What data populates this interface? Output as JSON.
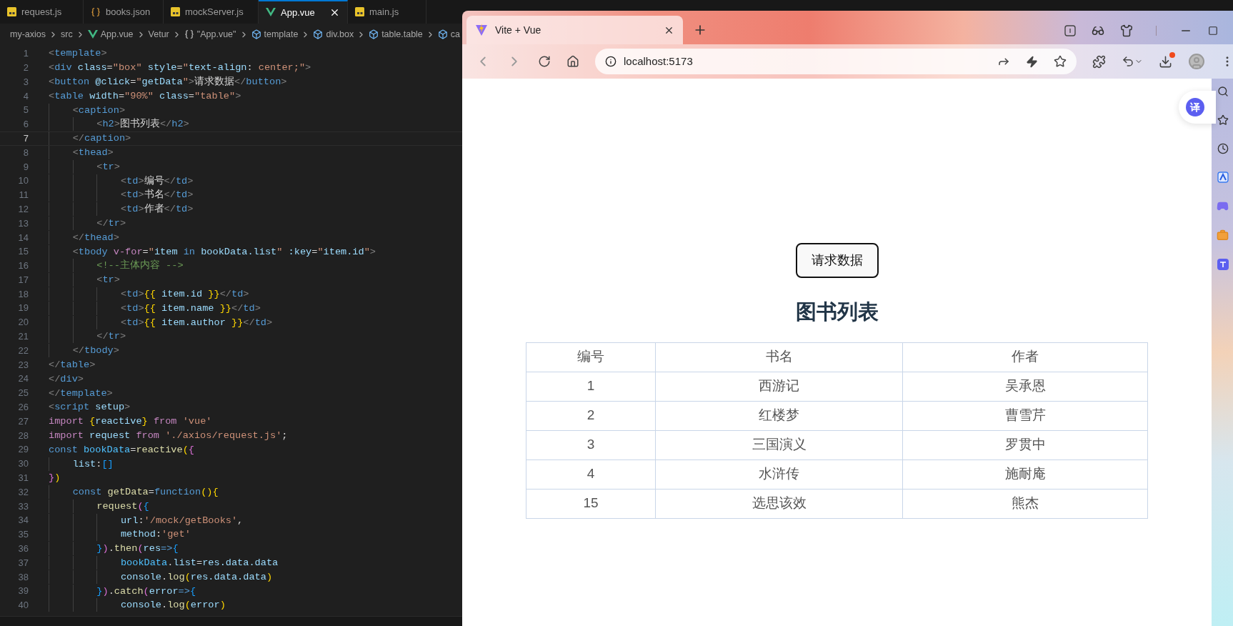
{
  "editor": {
    "tabs": [
      {
        "label": "request.js",
        "kind": "js",
        "selected": false
      },
      {
        "label": "books.json",
        "kind": "json",
        "selected": false
      },
      {
        "label": "mockServer.js",
        "kind": "js",
        "selected": false
      },
      {
        "label": "App.vue",
        "kind": "vue",
        "selected": true
      },
      {
        "label": "main.js",
        "kind": "js",
        "selected": false
      }
    ],
    "breadcrumbs": [
      {
        "label": "my-axios",
        "kind": "folder"
      },
      {
        "label": "src",
        "kind": "folder"
      },
      {
        "label": "App.vue",
        "kind": "vue"
      },
      {
        "label": "Vetur",
        "kind": "folder"
      },
      {
        "label": "\"App.vue\"",
        "kind": "braces"
      },
      {
        "label": "template",
        "kind": "element"
      },
      {
        "label": "div.box",
        "kind": "element"
      },
      {
        "label": "table.table",
        "kind": "element"
      },
      {
        "label": "ca",
        "kind": "element"
      }
    ],
    "lines": [
      {
        "number": "1",
        "current": false,
        "tokens": [
          {
            "text": "<",
            "kind": "punct"
          },
          {
            "text": "template",
            "kind": "tag"
          },
          {
            "text": ">",
            "kind": "punct"
          }
        ]
      },
      {
        "number": "2",
        "current": false,
        "tokens": [
          {
            "text": "<",
            "kind": "punct"
          },
          {
            "text": "div",
            "kind": "tag"
          },
          {
            "text": " class",
            "kind": "attr"
          },
          {
            "text": "=",
            "kind": "text"
          },
          {
            "text": "\"box\"",
            "kind": "string"
          },
          {
            "text": " style",
            "kind": "attr"
          },
          {
            "text": "=",
            "kind": "text"
          },
          {
            "text": "\"",
            "kind": "string"
          },
          {
            "text": "text-align",
            "kind": "attr"
          },
          {
            "text": ": ",
            "kind": "text"
          },
          {
            "text": "center;",
            "kind": "string"
          },
          {
            "text": "\"",
            "kind": "string"
          },
          {
            "text": ">",
            "kind": "punct"
          }
        ]
      },
      {
        "number": "3",
        "current": false,
        "tokens": [
          {
            "text": "<",
            "kind": "punct"
          },
          {
            "text": "button",
            "kind": "tag"
          },
          {
            "text": " @click",
            "kind": "attr"
          },
          {
            "text": "=",
            "kind": "text"
          },
          {
            "text": "\"",
            "kind": "string"
          },
          {
            "text": "getData",
            "kind": "variable"
          },
          {
            "text": "\"",
            "kind": "string"
          },
          {
            "text": ">",
            "kind": "punct"
          },
          {
            "text": "请求数据",
            "kind": "text"
          },
          {
            "text": "</",
            "kind": "punct"
          },
          {
            "text": "button",
            "kind": "tag"
          },
          {
            "text": ">",
            "kind": "punct"
          }
        ]
      },
      {
        "number": "4",
        "current": false,
        "tokens": [
          {
            "text": "<",
            "kind": "punct"
          },
          {
            "text": "table",
            "kind": "tag"
          },
          {
            "text": " width",
            "kind": "attr"
          },
          {
            "text": "=",
            "kind": "text"
          },
          {
            "text": "\"90%\"",
            "kind": "string"
          },
          {
            "text": " class",
            "kind": "attr"
          },
          {
            "text": "=",
            "kind": "text"
          },
          {
            "text": "\"table\"",
            "kind": "string"
          },
          {
            "text": ">",
            "kind": "punct"
          }
        ]
      },
      {
        "number": "5",
        "current": false,
        "tokens": [
          {
            "text": "    <",
            "kind": "punct"
          },
          {
            "text": "caption",
            "kind": "tag"
          },
          {
            "text": ">",
            "kind": "punct"
          }
        ]
      },
      {
        "number": "6",
        "current": false,
        "tokens": [
          {
            "text": "        <",
            "kind": "punct"
          },
          {
            "text": "h2",
            "kind": "tag"
          },
          {
            "text": ">",
            "kind": "punct"
          },
          {
            "text": "图书列表",
            "kind": "text"
          },
          {
            "text": "</",
            "kind": "punct"
          },
          {
            "text": "h2",
            "kind": "tag"
          },
          {
            "text": ">",
            "kind": "punct"
          }
        ]
      },
      {
        "number": "7",
        "current": true,
        "tokens": [
          {
            "text": "    </",
            "kind": "punct"
          },
          {
            "text": "caption",
            "kind": "tag"
          },
          {
            "text": ">",
            "kind": "punct"
          }
        ]
      },
      {
        "number": "8",
        "current": false,
        "tokens": [
          {
            "text": "    <",
            "kind": "punct"
          },
          {
            "text": "thead",
            "kind": "tag"
          },
          {
            "text": ">",
            "kind": "punct"
          }
        ]
      },
      {
        "number": "9",
        "current": false,
        "tokens": [
          {
            "text": "        <",
            "kind": "punct"
          },
          {
            "text": "tr",
            "kind": "tag"
          },
          {
            "text": ">",
            "kind": "punct"
          }
        ]
      },
      {
        "number": "10",
        "current": false,
        "tokens": [
          {
            "text": "            <",
            "kind": "punct"
          },
          {
            "text": "td",
            "kind": "tag"
          },
          {
            "text": ">",
            "kind": "punct"
          },
          {
            "text": "编号",
            "kind": "text"
          },
          {
            "text": "</",
            "kind": "punct"
          },
          {
            "text": "td",
            "kind": "tag"
          },
          {
            "text": ">",
            "kind": "punct"
          }
        ]
      },
      {
        "number": "11",
        "current": false,
        "tokens": [
          {
            "text": "            <",
            "kind": "punct"
          },
          {
            "text": "td",
            "kind": "tag"
          },
          {
            "text": ">",
            "kind": "punct"
          },
          {
            "text": "书名",
            "kind": "text"
          },
          {
            "text": "</",
            "kind": "punct"
          },
          {
            "text": "td",
            "kind": "tag"
          },
          {
            "text": ">",
            "kind": "punct"
          }
        ]
      },
      {
        "number": "12",
        "current": false,
        "tokens": [
          {
            "text": "            <",
            "kind": "punct"
          },
          {
            "text": "td",
            "kind": "tag"
          },
          {
            "text": ">",
            "kind": "punct"
          },
          {
            "text": "作者",
            "kind": "text"
          },
          {
            "text": "</",
            "kind": "punct"
          },
          {
            "text": "td",
            "kind": "tag"
          },
          {
            "text": ">",
            "kind": "punct"
          }
        ]
      },
      {
        "number": "13",
        "current": false,
        "tokens": [
          {
            "text": "        </",
            "kind": "punct"
          },
          {
            "text": "tr",
            "kind": "tag"
          },
          {
            "text": ">",
            "kind": "punct"
          }
        ]
      },
      {
        "number": "14",
        "current": false,
        "tokens": [
          {
            "text": "    </",
            "kind": "punct"
          },
          {
            "text": "thead",
            "kind": "tag"
          },
          {
            "text": ">",
            "kind": "punct"
          }
        ]
      },
      {
        "number": "15",
        "current": false,
        "tokens": [
          {
            "text": "    <",
            "kind": "punct"
          },
          {
            "text": "tbody",
            "kind": "tag"
          },
          {
            "text": " v-for",
            "kind": "keyword"
          },
          {
            "text": "=",
            "kind": "text"
          },
          {
            "text": "\"",
            "kind": "string"
          },
          {
            "text": "item ",
            "kind": "variable"
          },
          {
            "text": "in",
            "kind": "storage"
          },
          {
            "text": " bookData.list",
            "kind": "variable"
          },
          {
            "text": "\"",
            "kind": "string"
          },
          {
            "text": " :key",
            "kind": "attr"
          },
          {
            "text": "=",
            "kind": "text"
          },
          {
            "text": "\"",
            "kind": "string"
          },
          {
            "text": "item.id",
            "kind": "variable"
          },
          {
            "text": "\"",
            "kind": "string"
          },
          {
            "text": ">",
            "kind": "punct"
          }
        ]
      },
      {
        "number": "16",
        "current": false,
        "tokens": [
          {
            "text": "        <!--主体内容 -->",
            "kind": "comment"
          }
        ]
      },
      {
        "number": "17",
        "current": false,
        "tokens": [
          {
            "text": "        <",
            "kind": "punct"
          },
          {
            "text": "tr",
            "kind": "tag"
          },
          {
            "text": ">",
            "kind": "punct"
          }
        ]
      },
      {
        "number": "18",
        "current": false,
        "tokens": [
          {
            "text": "            <",
            "kind": "punct"
          },
          {
            "text": "td",
            "kind": "tag"
          },
          {
            "text": ">",
            "kind": "punct"
          },
          {
            "text": "{{",
            "kind": "bracket1"
          },
          {
            "text": " item.id ",
            "kind": "variable"
          },
          {
            "text": "}}",
            "kind": "bracket1"
          },
          {
            "text": "</",
            "kind": "punct"
          },
          {
            "text": "td",
            "kind": "tag"
          },
          {
            "text": ">",
            "kind": "punct"
          }
        ]
      },
      {
        "number": "19",
        "current": false,
        "tokens": [
          {
            "text": "            <",
            "kind": "punct"
          },
          {
            "text": "td",
            "kind": "tag"
          },
          {
            "text": ">",
            "kind": "punct"
          },
          {
            "text": "{{",
            "kind": "bracket1"
          },
          {
            "text": " item.name ",
            "kind": "variable"
          },
          {
            "text": "}}",
            "kind": "bracket1"
          },
          {
            "text": "</",
            "kind": "punct"
          },
          {
            "text": "td",
            "kind": "tag"
          },
          {
            "text": ">",
            "kind": "punct"
          }
        ]
      },
      {
        "number": "20",
        "current": false,
        "tokens": [
          {
            "text": "            <",
            "kind": "punct"
          },
          {
            "text": "td",
            "kind": "tag"
          },
          {
            "text": ">",
            "kind": "punct"
          },
          {
            "text": "{{",
            "kind": "bracket1"
          },
          {
            "text": " item.author ",
            "kind": "variable"
          },
          {
            "text": "}}",
            "kind": "bracket1"
          },
          {
            "text": "</",
            "kind": "punct"
          },
          {
            "text": "td",
            "kind": "tag"
          },
          {
            "text": ">",
            "kind": "punct"
          }
        ]
      },
      {
        "number": "21",
        "current": false,
        "tokens": [
          {
            "text": "        </",
            "kind": "punct"
          },
          {
            "text": "tr",
            "kind": "tag"
          },
          {
            "text": ">",
            "kind": "punct"
          }
        ]
      },
      {
        "number": "22",
        "current": false,
        "tokens": [
          {
            "text": "    </",
            "kind": "punct"
          },
          {
            "text": "tbody",
            "kind": "tag"
          },
          {
            "text": ">",
            "kind": "punct"
          }
        ]
      },
      {
        "number": "23",
        "current": false,
        "tokens": [
          {
            "text": "</",
            "kind": "punct"
          },
          {
            "text": "table",
            "kind": "tag"
          },
          {
            "text": ">",
            "kind": "punct"
          }
        ]
      },
      {
        "number": "24",
        "current": false,
        "tokens": [
          {
            "text": "</",
            "kind": "punct"
          },
          {
            "text": "div",
            "kind": "tag"
          },
          {
            "text": ">",
            "kind": "punct"
          }
        ]
      },
      {
        "number": "25",
        "current": false,
        "tokens": [
          {
            "text": "</",
            "kind": "punct"
          },
          {
            "text": "template",
            "kind": "tag"
          },
          {
            "text": ">",
            "kind": "punct"
          }
        ]
      },
      {
        "number": "26",
        "current": false,
        "tokens": [
          {
            "text": "<",
            "kind": "punct"
          },
          {
            "text": "script",
            "kind": "tag"
          },
          {
            "text": " setup",
            "kind": "attr"
          },
          {
            "text": ">",
            "kind": "punct"
          }
        ]
      },
      {
        "number": "27",
        "current": false,
        "tokens": [
          {
            "text": "import ",
            "kind": "keyword"
          },
          {
            "text": "{",
            "kind": "bracket1"
          },
          {
            "text": "reactive",
            "kind": "variable"
          },
          {
            "text": "}",
            "kind": "bracket1"
          },
          {
            "text": " from ",
            "kind": "keyword"
          },
          {
            "text": "'vue'",
            "kind": "string"
          }
        ]
      },
      {
        "number": "28",
        "current": false,
        "tokens": [
          {
            "text": "import",
            "kind": "keyword"
          },
          {
            "text": " request ",
            "kind": "variable"
          },
          {
            "text": "from ",
            "kind": "keyword"
          },
          {
            "text": "'./axios/request.js'",
            "kind": "string"
          },
          {
            "text": ";",
            "kind": "text"
          }
        ]
      },
      {
        "number": "29",
        "current": false,
        "tokens": [
          {
            "text": "const ",
            "kind": "storage"
          },
          {
            "text": "bookData",
            "kind": "constant"
          },
          {
            "text": "=",
            "kind": "text"
          },
          {
            "text": "reactive",
            "kind": "function"
          },
          {
            "text": "(",
            "kind": "bracket1"
          },
          {
            "text": "{",
            "kind": "bracket2"
          }
        ]
      },
      {
        "number": "30",
        "current": false,
        "tokens": [
          {
            "text": "    list",
            "kind": "variable"
          },
          {
            "text": ":",
            "kind": "text"
          },
          {
            "text": "[]",
            "kind": "bracket3"
          }
        ]
      },
      {
        "number": "31",
        "current": false,
        "tokens": [
          {
            "text": "}",
            "kind": "bracket2"
          },
          {
            "text": ")",
            "kind": "bracket1"
          }
        ]
      },
      {
        "number": "32",
        "current": false,
        "tokens": [
          {
            "text": "    const ",
            "kind": "storage"
          },
          {
            "text": "getData",
            "kind": "function"
          },
          {
            "text": "=",
            "kind": "text"
          },
          {
            "text": "function",
            "kind": "storage"
          },
          {
            "text": "(){",
            "kind": "bracket1"
          }
        ]
      },
      {
        "number": "33",
        "current": false,
        "tokens": [
          {
            "text": "        request",
            "kind": "function"
          },
          {
            "text": "(",
            "kind": "bracket2"
          },
          {
            "text": "{",
            "kind": "bracket3"
          }
        ]
      },
      {
        "number": "34",
        "current": false,
        "tokens": [
          {
            "text": "            url",
            "kind": "variable"
          },
          {
            "text": ":",
            "kind": "text"
          },
          {
            "text": "'/mock/getBooks'",
            "kind": "string"
          },
          {
            "text": ",",
            "kind": "text"
          }
        ]
      },
      {
        "number": "35",
        "current": false,
        "tokens": [
          {
            "text": "            method",
            "kind": "variable"
          },
          {
            "text": ":",
            "kind": "text"
          },
          {
            "text": "'get'",
            "kind": "string"
          }
        ]
      },
      {
        "number": "36",
        "current": false,
        "tokens": [
          {
            "text": "        }",
            "kind": "bracket3"
          },
          {
            "text": ")",
            "kind": "bracket2"
          },
          {
            "text": ".",
            "kind": "text"
          },
          {
            "text": "then",
            "kind": "function"
          },
          {
            "text": "(",
            "kind": "bracket2"
          },
          {
            "text": "res",
            "kind": "variable"
          },
          {
            "text": "=>",
            "kind": "storage"
          },
          {
            "text": "{",
            "kind": "bracket3"
          }
        ]
      },
      {
        "number": "37",
        "current": false,
        "tokens": [
          {
            "text": "            bookData",
            "kind": "constant"
          },
          {
            "text": ".",
            "kind": "text"
          },
          {
            "text": "list",
            "kind": "variable"
          },
          {
            "text": "=",
            "kind": "text"
          },
          {
            "text": "res.data.data",
            "kind": "variable"
          }
        ]
      },
      {
        "number": "38",
        "current": false,
        "tokens": [
          {
            "text": "            console",
            "kind": "variable"
          },
          {
            "text": ".",
            "kind": "text"
          },
          {
            "text": "log",
            "kind": "function"
          },
          {
            "text": "(",
            "kind": "bracket1"
          },
          {
            "text": "res.data.data",
            "kind": "variable"
          },
          {
            "text": ")",
            "kind": "bracket1"
          }
        ]
      },
      {
        "number": "39",
        "current": false,
        "tokens": [
          {
            "text": "        }",
            "kind": "bracket3"
          },
          {
            "text": ")",
            "kind": "bracket2"
          },
          {
            "text": ".",
            "kind": "text"
          },
          {
            "text": "catch",
            "kind": "function"
          },
          {
            "text": "(",
            "kind": "bracket2"
          },
          {
            "text": "error",
            "kind": "variable"
          },
          {
            "text": "=>",
            "kind": "storage"
          },
          {
            "text": "{",
            "kind": "bracket3"
          }
        ]
      },
      {
        "number": "40",
        "current": false,
        "tokens": [
          {
            "text": "            console",
            "kind": "variable"
          },
          {
            "text": ".",
            "kind": "text"
          },
          {
            "text": "log",
            "kind": "function"
          },
          {
            "text": "(",
            "kind": "bracket1"
          },
          {
            "text": "error",
            "kind": "variable"
          },
          {
            "text": ")",
            "kind": "bracket1"
          }
        ]
      }
    ]
  },
  "browser": {
    "tab": {
      "title": "Vite + Vue"
    },
    "address": "localhost:5173",
    "page": {
      "button": "请求数据",
      "heading": "图书列表",
      "table": {
        "columns": [
          "编号",
          "书名",
          "作者"
        ],
        "rows": [
          [
            "1",
            "西游记",
            "吴承恩"
          ],
          [
            "2",
            "红楼梦",
            "曹雪芹"
          ],
          [
            "3",
            "三国演义",
            "罗贯中"
          ],
          [
            "4",
            "水浒传",
            "施耐庵"
          ],
          [
            "15",
            "选思该效",
            "熊杰"
          ]
        ]
      },
      "translate_button": "译"
    }
  }
}
